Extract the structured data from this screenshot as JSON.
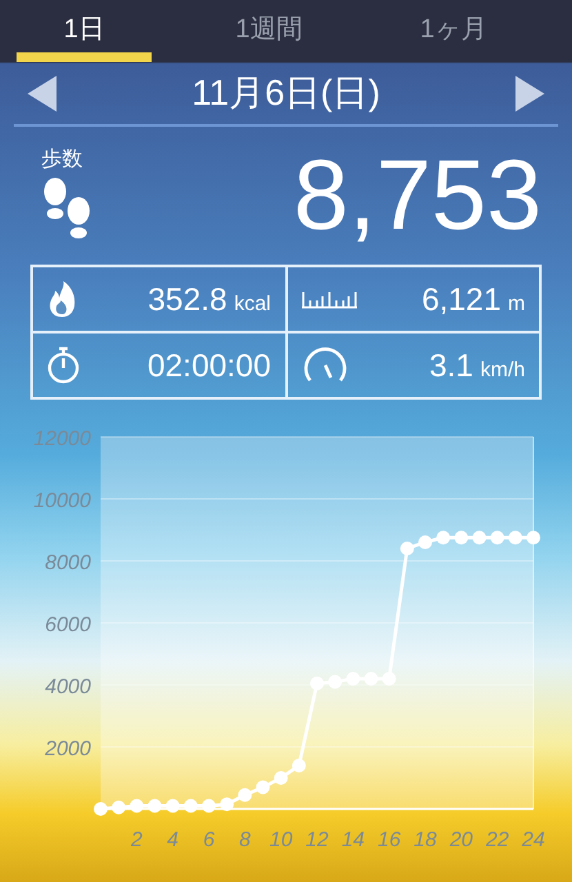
{
  "tabs": [
    {
      "label": "1日",
      "selected": true
    },
    {
      "label": "1週間",
      "selected": false
    },
    {
      "label": "1ヶ月",
      "selected": false
    }
  ],
  "date": "11月6日(日)",
  "steps": {
    "label": "歩数",
    "value": "8,753"
  },
  "stats": [
    {
      "kind": "calories",
      "value": "352.8",
      "unit": "kcal"
    },
    {
      "kind": "distance",
      "value": "6,121",
      "unit": "m"
    },
    {
      "kind": "time",
      "value": "02:00:00"
    },
    {
      "kind": "speed",
      "value": "3.1",
      "unit": "km/h"
    }
  ],
  "chart": {
    "chart_data": {
      "type": "line",
      "x": [
        0,
        1,
        2,
        3,
        4,
        5,
        6,
        7,
        8,
        9,
        10,
        11,
        12,
        13,
        14,
        15,
        16,
        17,
        18,
        19,
        20,
        21,
        22,
        23,
        24
      ],
      "series": [
        {
          "color": "#ffffff",
          "marker": true,
          "values": [
            0,
            50,
            100,
            100,
            100,
            100,
            100,
            150,
            450,
            700,
            1000,
            1400,
            4050,
            4100,
            4200,
            4200,
            4200,
            8400,
            8600,
            8750,
            8750,
            8750,
            8750,
            8750,
            8750
          ]
        }
      ],
      "grid": true,
      "xlim": [
        0,
        24
      ],
      "ylim": [
        0,
        12000
      ],
      "xticks": [
        2,
        4,
        6,
        8,
        10,
        12,
        14,
        16,
        18,
        20,
        22,
        24
      ],
      "yticks": [
        2000,
        4000,
        6000,
        8000,
        10000,
        12000
      ]
    }
  }
}
